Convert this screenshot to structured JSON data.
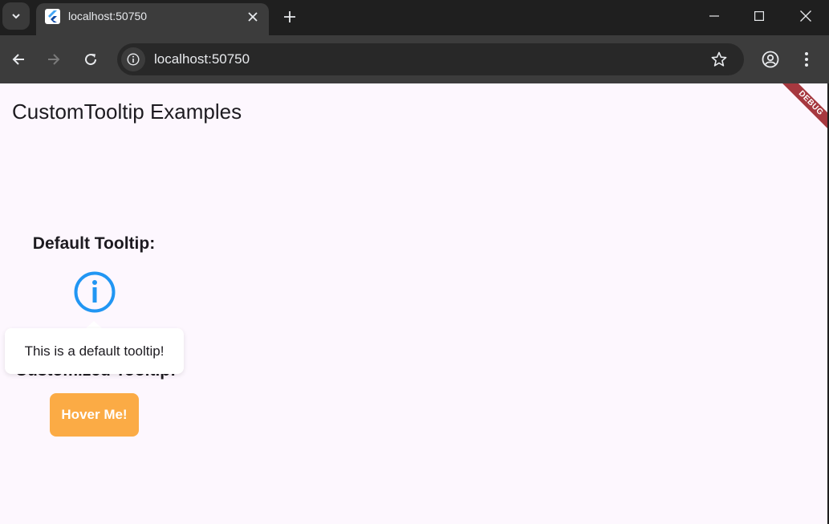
{
  "browser": {
    "tab_title": "localhost:50750",
    "url": "localhost:50750",
    "icons": [
      "tab-search-icon",
      "flutter-favicon",
      "close-icon",
      "plus-icon",
      "minimize-icon",
      "maximize-icon",
      "close-window-icon",
      "back-arrow-icon",
      "forward-arrow-icon",
      "reload-icon",
      "site-info-icon",
      "star-icon",
      "profile-icon",
      "more-menu-icon"
    ]
  },
  "page": {
    "title": "CustomTooltip Examples",
    "debug_banner": "DEBUG",
    "default_section_label": "Default Tooltip:",
    "custom_section_label": "Customized Tooltip:",
    "hover_button_label": "Hover Me!",
    "tooltip_text": "This is a default tooltip!"
  },
  "colors": {
    "page_background": "#fdf7fe",
    "info_icon": "#2196f3",
    "hover_button": "#fbab45",
    "debug_banner": "#a6383f",
    "chrome_dark": "#1f1f1f",
    "chrome_toolbar": "#3c3c3c"
  }
}
